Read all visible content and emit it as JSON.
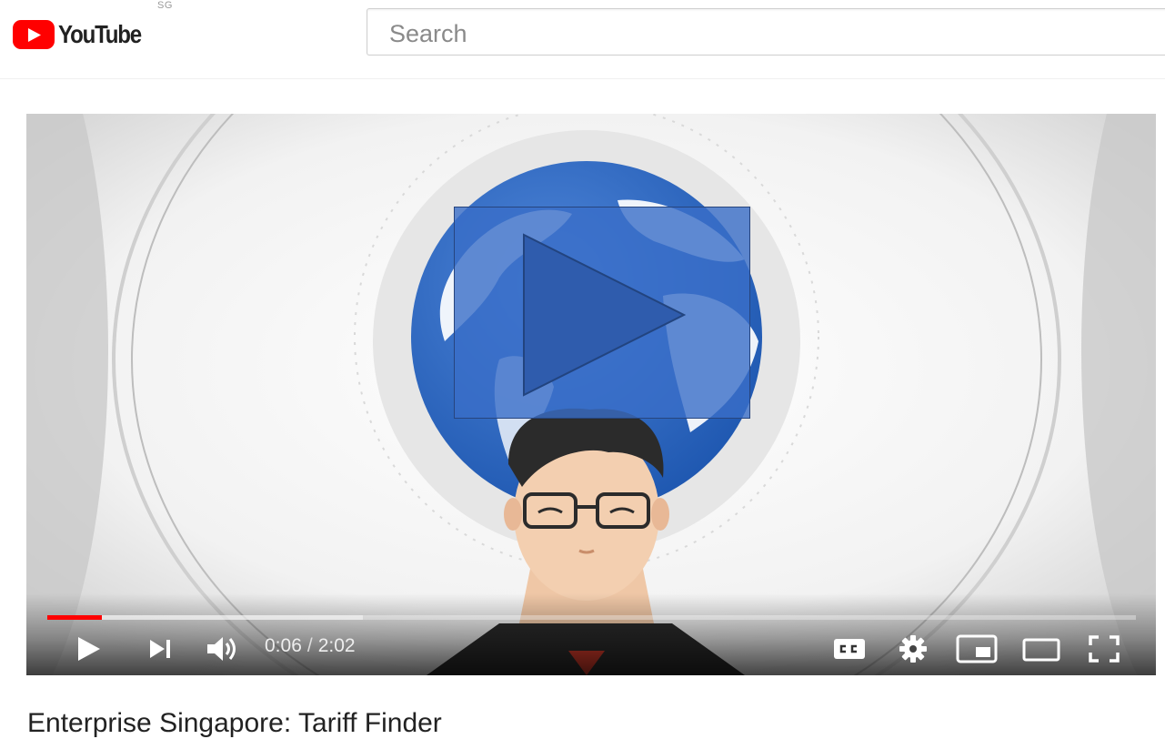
{
  "header": {
    "logo_text": "YouTube",
    "region": "SG",
    "search_placeholder": "Search"
  },
  "player": {
    "progress_fraction": 0.05,
    "buffered_fraction": 0.29,
    "time_current": "0:06",
    "time_separator": "/",
    "time_duration": "2:02",
    "controls": [
      "play-icon",
      "next-icon",
      "volume-icon",
      "captions-icon",
      "settings-icon",
      "miniplayer-icon",
      "theater-icon",
      "fullscreen-icon"
    ]
  },
  "video": {
    "title": "Enterprise Singapore: Tariff Finder"
  },
  "colors": {
    "brand_red": "#ff0000",
    "overlay_blue": "#3a6ec8"
  }
}
